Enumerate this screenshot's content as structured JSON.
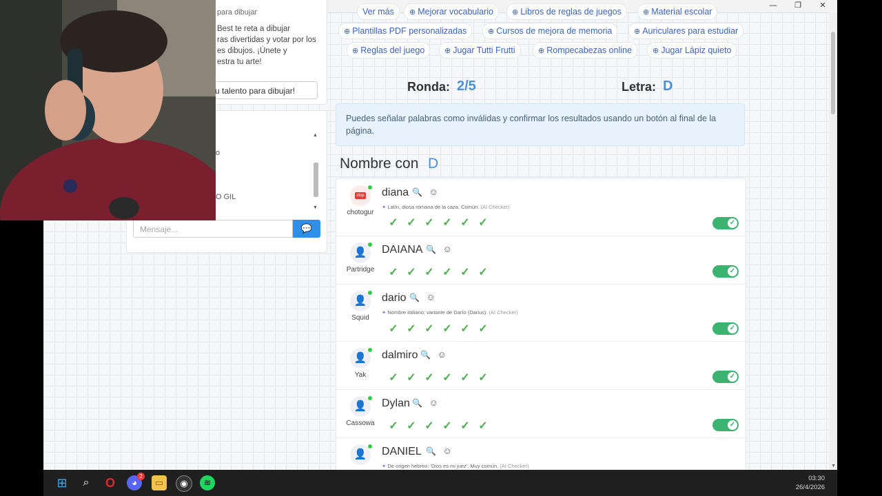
{
  "window": {
    "minimize": "—",
    "restore": "❐",
    "close": "✕"
  },
  "intro": {
    "title_fragment": "para dibujar",
    "lines": [
      "Best te reta a dibujar",
      "ras divertidas y votar por los",
      "es dibujos. ¡Únete y",
      "estra tu arte!"
    ],
    "cta": "u talento para dibujar!"
  },
  "chat": {
    "lines": [
      "o",
      "O GIL"
    ],
    "placeholder": "Mensaje...",
    "send_icon": "speech-bubble-icon"
  },
  "chips_row0": [
    "Ver más",
    "Mejorar vocabulario",
    "Libros de reglas de juegos",
    "Material escolar"
  ],
  "chips_row1": [
    "Plantillas PDF personalizadas",
    "Cursos de mejora de memoria",
    "Auriculares para estudiar"
  ],
  "chips_row2": [
    "Reglas del juego",
    "Jugar Tutti Frutti",
    "Rompecabezas online",
    "Jugar Lápiz quieto"
  ],
  "round": {
    "label": "Ronda:",
    "value": "2/5"
  },
  "letter": {
    "label": "Letra:",
    "value": "D"
  },
  "info": "Puedes señalar palabras como inválidas y confirmar los resultados usando un botón al final de la página.",
  "category": {
    "title": "Nombre con",
    "letter": "D"
  },
  "answers": [
    {
      "word": "diana",
      "player": "chotogur",
      "definition": "Latín, diosa romana de la caza. Común.",
      "source": "(AI Checker)",
      "avatar": "stop-sign-icon",
      "avatar_label": "stop"
    },
    {
      "word": "DAIANA",
      "player": "Partridge",
      "definition": "",
      "source": "",
      "avatar": "user-icon"
    },
    {
      "word": "dario",
      "player": "Squid",
      "definition": "Nombre italiano; variante de Darío (Darius).",
      "source": "(AI Checker)",
      "avatar": "user-star-icon"
    },
    {
      "word": "dalmiro",
      "player": "Yak",
      "definition": "",
      "source": "",
      "avatar": "user-icon"
    },
    {
      "word": "Dylan",
      "player": "Cassowa",
      "definition": "",
      "source": "",
      "avatar": "user-icon"
    },
    {
      "word": "DANIEL",
      "player": "",
      "definition": "De origen hebreo: 'Dios es mi juez'. Muy común.",
      "source": "(AI Checker)",
      "avatar": "user-icon"
    }
  ],
  "vote_mark": "✓",
  "votes_per_row": 6,
  "taskbar": {
    "time": "03:30",
    "date": "26/4/2026",
    "discord_badge": "2",
    "icons": [
      "windows-start-icon",
      "search-icon",
      "opera-browser-icon",
      "discord-icon",
      "file-explorer-icon",
      "obs-icon",
      "spotify-icon"
    ]
  }
}
